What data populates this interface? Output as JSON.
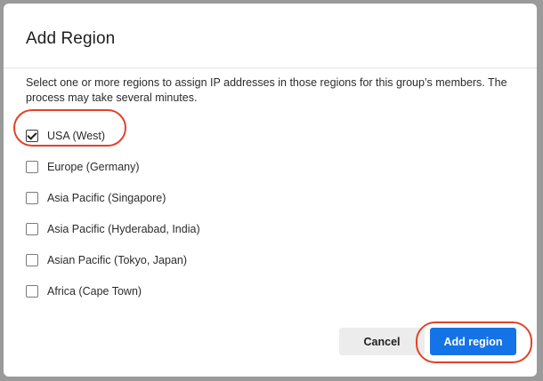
{
  "dialog": {
    "title": "Add Region",
    "description": "Select one or more regions to assign IP addresses in those regions for this group’s members. The process may take several minutes.",
    "regions": [
      {
        "label": "USA (West)",
        "checked": true
      },
      {
        "label": "Europe (Germany)",
        "checked": false
      },
      {
        "label": "Asia Pacific (Singapore)",
        "checked": false
      },
      {
        "label": "Asia Pacific (Hyderabad, India)",
        "checked": false
      },
      {
        "label": "Asian Pacific (Tokyo, Japan)",
        "checked": false
      },
      {
        "label": "Africa (Cape Town)",
        "checked": false
      }
    ],
    "buttons": {
      "cancel": "Cancel",
      "add": "Add region"
    }
  },
  "colors": {
    "primary": "#1473e6",
    "highlight_ring": "#e0432c",
    "cancel_bg": "#ececec"
  }
}
